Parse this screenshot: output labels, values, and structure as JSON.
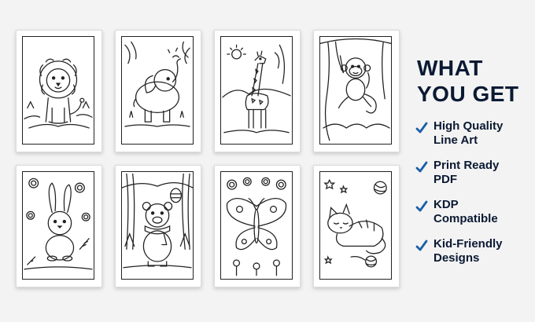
{
  "pages": [
    {
      "subject": "lion"
    },
    {
      "subject": "elephant"
    },
    {
      "subject": "giraffe"
    },
    {
      "subject": "monkey"
    },
    {
      "subject": "bunny"
    },
    {
      "subject": "bear"
    },
    {
      "subject": "butterfly"
    },
    {
      "subject": "cat"
    }
  ],
  "panel": {
    "title_line1": "WHAT",
    "title_line2": "YOU GET",
    "features": [
      {
        "line1": "High Quality",
        "line2": "Line Art"
      },
      {
        "line1": "Print Ready",
        "line2": "PDF"
      },
      {
        "line1": "KDP",
        "line2": "Compatible"
      },
      {
        "line1": "Kid-Friendly",
        "line2": "Designs"
      }
    ],
    "check_icon": "checkmark-icon",
    "text_color": "#0b1a33",
    "check_color": "#1a5fa8"
  }
}
